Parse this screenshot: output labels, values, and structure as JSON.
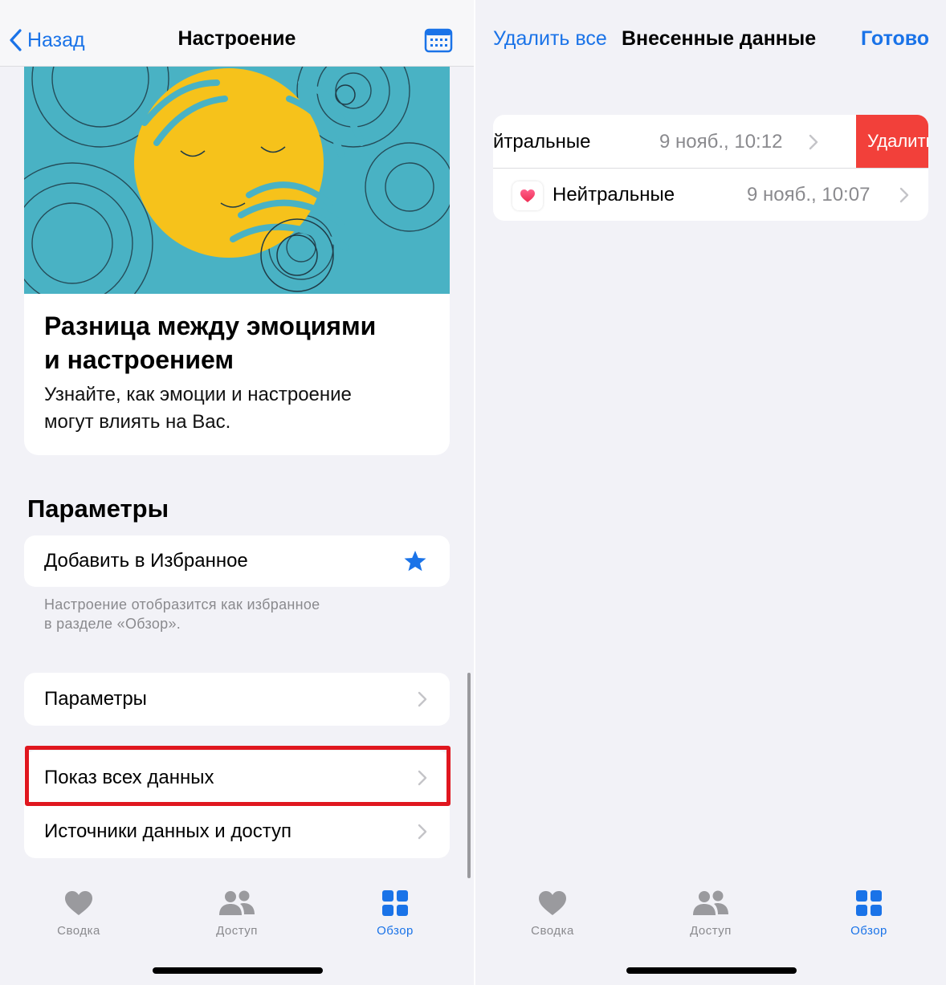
{
  "left": {
    "nav": {
      "back_label": "Назад",
      "title": "Настроение",
      "calendar_icon": "calendar-icon"
    },
    "article": {
      "title_line1": "Разница между эмоциями",
      "title_line2": "и настроением",
      "desc_line1": "Узнайте, как эмоции и настроение",
      "desc_line2": "могут влиять на Вас."
    },
    "section_header": "Параметры",
    "favorite": {
      "label": "Добавить в Избранное",
      "icon": "star-icon",
      "footnote_line1": "Настроение отобразится как избранное",
      "footnote_line2": "в разделе «Обзор»."
    },
    "settings_row": "Параметры",
    "show_all_data_row": "Показ всех данных",
    "sources_row": "Источники данных и доступ"
  },
  "right": {
    "nav": {
      "delete_all": "Удалить все",
      "title": "Внесенные данные",
      "done": "Готово"
    },
    "entries": [
      {
        "label": "йтральные",
        "date": "9 нояб., 10:12",
        "action": "Удалить"
      },
      {
        "label": "Нейтральные",
        "date": "9 нояб., 10:07",
        "icon": "heart-icon"
      }
    ]
  },
  "tabs": [
    {
      "label": "Сводка",
      "icon": "heart-icon",
      "active": false
    },
    {
      "label": "Доступ",
      "icon": "people-icon",
      "active": false
    },
    {
      "label": "Обзор",
      "icon": "grid-icon",
      "active": true
    }
  ],
  "colors": {
    "accent": "#1a73e8",
    "background": "#f2f2f7",
    "delete": "#f2403a",
    "highlight": "#e0171f",
    "art_bg": "#49b2c4",
    "art_sun": "#f6c21b"
  }
}
